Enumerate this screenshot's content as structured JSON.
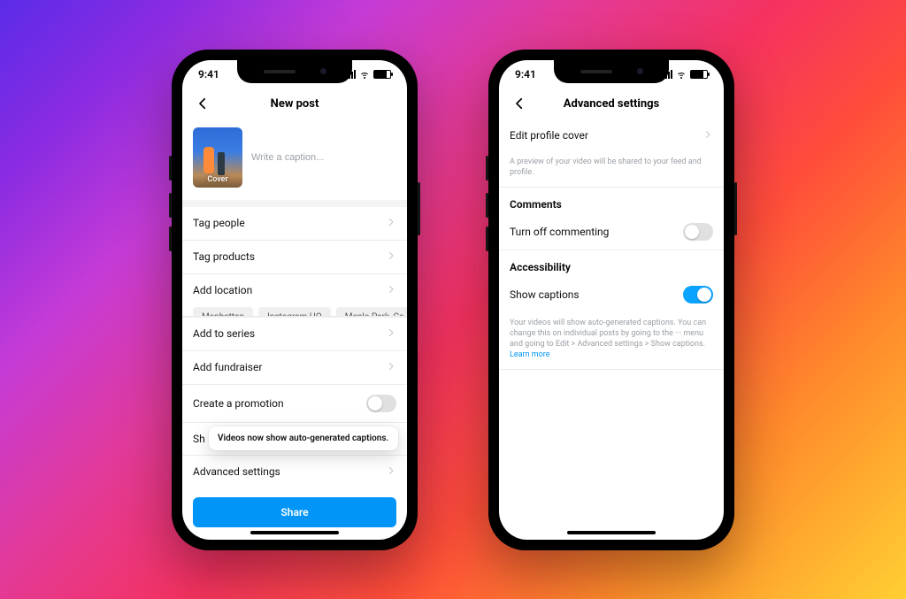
{
  "status": {
    "time": "9:41"
  },
  "phone1": {
    "title": "New post",
    "caption_placeholder": "Write a caption...",
    "cover_label": "Cover",
    "rows": {
      "tag_people": "Tag people",
      "tag_products": "Tag products",
      "add_location": "Add location",
      "add_to_series": "Add to series",
      "add_fundraiser": "Add fundraiser",
      "create_promotion": "Create a promotion",
      "share_to": "Sh",
      "advanced_settings": "Advanced settings"
    },
    "location_chips": [
      "Manhattan",
      "Instagram HQ",
      "Menlo Park, Ca"
    ],
    "tooltip": "Videos now show auto-generated captions.",
    "share_button": "Share",
    "promotion_on": false
  },
  "phone2": {
    "title": "Advanced settings",
    "edit_profile_cover": "Edit profile cover",
    "edit_profile_helper": "A preview of your video will be shared to your feed and profile.",
    "comments_section": "Comments",
    "turn_off_commenting": "Turn off commenting",
    "commenting_on": false,
    "accessibility_section": "Accessibility",
    "show_captions": "Show captions",
    "captions_on": true,
    "captions_helper": "Your videos will show auto-generated captions. You can change this on individual posts by going to the  ···  menu and going to Edit > Advanced settings > Show captions.",
    "learn_more": "Learn more"
  }
}
